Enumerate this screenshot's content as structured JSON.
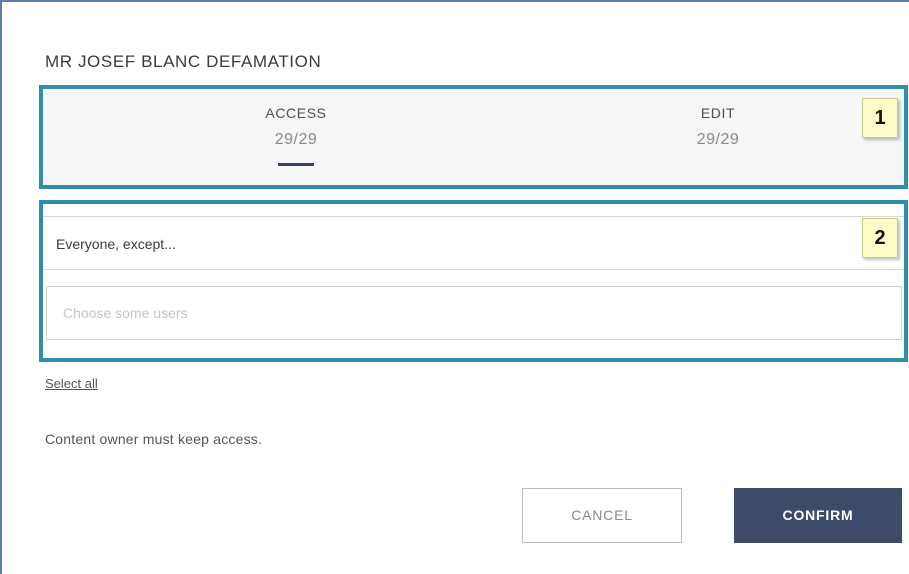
{
  "dialog": {
    "title": "MR JOSEF BLANC DEFAMATION"
  },
  "tabs": [
    {
      "label": "ACCESS",
      "count": "29/29",
      "active": true
    },
    {
      "label": "EDIT",
      "count": "29/29",
      "active": false
    }
  ],
  "callouts": {
    "badge1": "1",
    "badge2": "2"
  },
  "access": {
    "mode_value": "Everyone, except...",
    "users_placeholder": "Choose some users"
  },
  "links": {
    "select_all": "Select all"
  },
  "notes": {
    "owner_access": "Content owner must keep access."
  },
  "buttons": {
    "cancel": "CANCEL",
    "confirm": "CONFIRM"
  },
  "colors": {
    "callout_border": "#2f8fab",
    "confirm_bg": "#3e4a69",
    "active_tab_underline": "#354263",
    "badge_bg": "#fdfbc8"
  }
}
